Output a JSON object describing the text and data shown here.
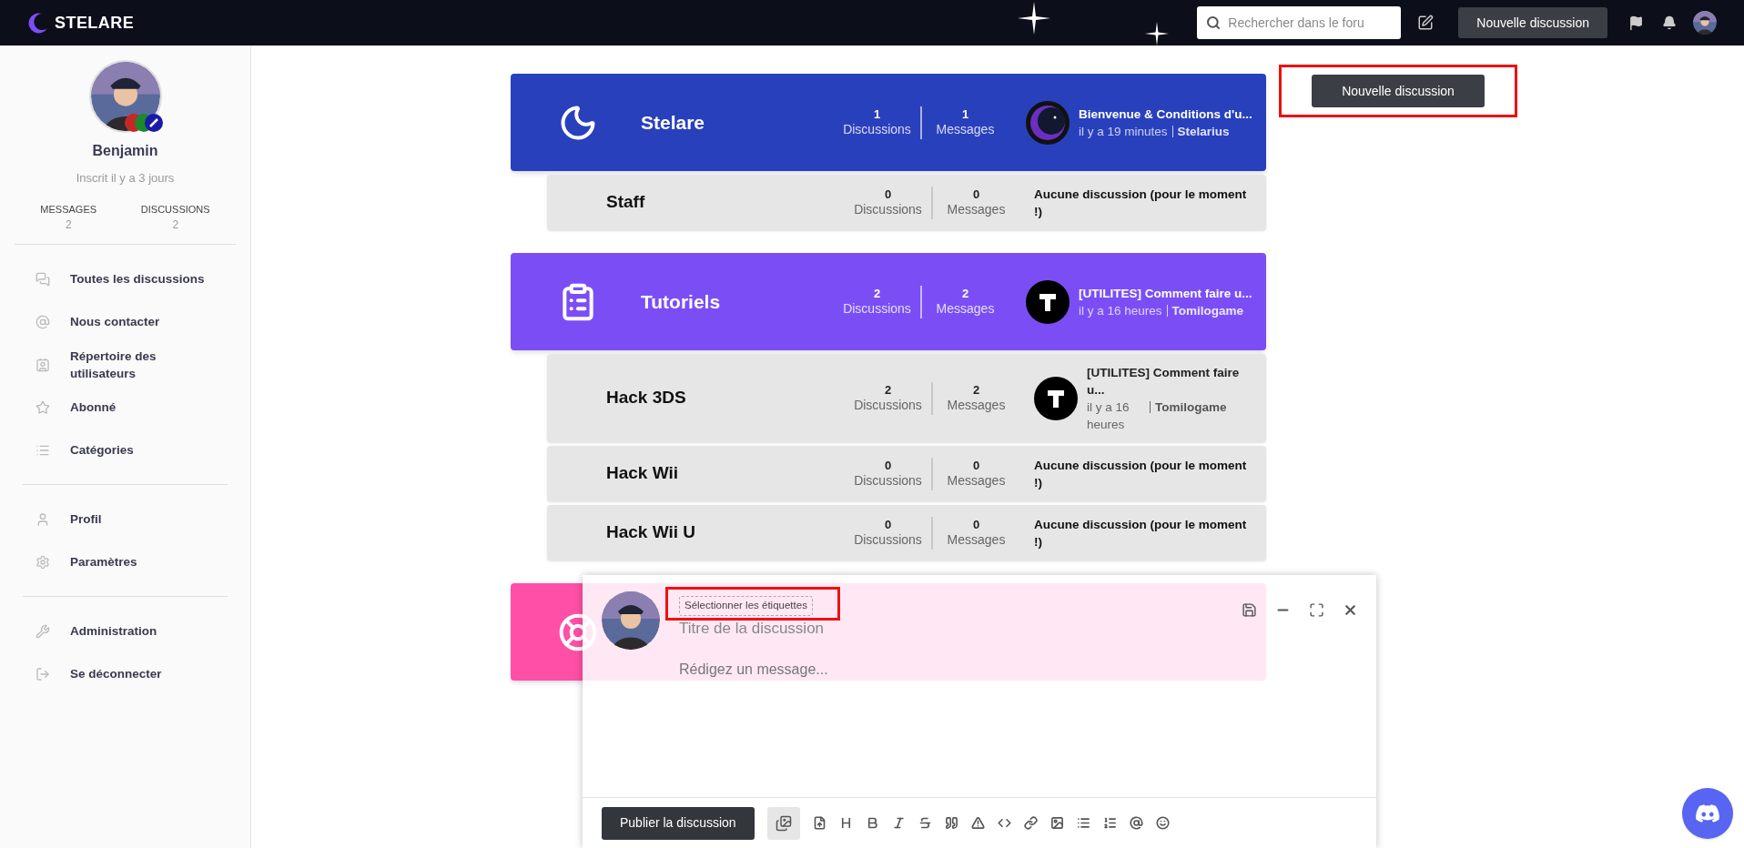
{
  "header": {
    "logo": "STELARE",
    "search": {
      "placeholder": "Rechercher dans le foru"
    },
    "new_button": "Nouvelle discussion"
  },
  "sidebar": {
    "user": {
      "name": "Benjamin",
      "joined": "Inscrit il y a 3 jours",
      "stats": [
        {
          "label": "MESSAGES",
          "value": "2"
        },
        {
          "label": "DISCUSSIONS",
          "value": "2"
        }
      ]
    },
    "nav_groups": [
      [
        "Toutes les discussions",
        "Nous contacter",
        "Répertoire des utilisateurs",
        "Abonné",
        "Catégories"
      ],
      [
        "Profil",
        "Paramètres"
      ],
      [
        "Administration",
        "Se déconnecter"
      ]
    ]
  },
  "new_discussion_button": "Nouvelle discussion",
  "categories": [
    {
      "name": "Stelare",
      "color": "#2940bd",
      "stats": [
        {
          "value": "1",
          "label": "Discussions"
        },
        {
          "value": "1",
          "label": "Messages"
        }
      ],
      "last": {
        "title": "Bienvenue & Conditions d'u...",
        "time": "il y a 19 minutes",
        "author": "Stelarius"
      },
      "children": [
        {
          "name": "Staff",
          "stats": [
            {
              "value": "0",
              "label": "Discussions"
            },
            {
              "value": "0",
              "label": "Messages"
            }
          ],
          "empty_text": "Aucune discussion (pour le moment !)"
        }
      ]
    },
    {
      "name": "Tutoriels",
      "color": "#7b4ef5",
      "stats": [
        {
          "value": "2",
          "label": "Discussions"
        },
        {
          "value": "2",
          "label": "Messages"
        }
      ],
      "last": {
        "title": "[UTILITES] Comment faire u...",
        "time": "il y a 16 heures",
        "author": "Tomilogame"
      },
      "children": [
        {
          "name": "Hack 3DS",
          "stats": [
            {
              "value": "2",
              "label": "Discussions"
            },
            {
              "value": "2",
              "label": "Messages"
            }
          ],
          "last": {
            "title": "[UTILITES] Comment faire u...",
            "time": "il y a 16 heures",
            "author": "Tomilogame"
          }
        },
        {
          "name": "Hack Wii",
          "stats": [
            {
              "value": "0",
              "label": "Discussions"
            },
            {
              "value": "0",
              "label": "Messages"
            }
          ],
          "empty_text": "Aucune discussion (pour le moment !)"
        },
        {
          "name": "Hack Wii U",
          "stats": [
            {
              "value": "0",
              "label": "Discussions"
            },
            {
              "value": "0",
              "label": "Messages"
            }
          ],
          "empty_text": "Aucune discussion (pour le moment !)"
        }
      ]
    },
    {
      "color": "#ff4fa6"
    }
  ],
  "composer": {
    "tags_button": "Sélectionner les étiquettes",
    "title_placeholder": "Titre de la discussion",
    "body_placeholder": "Rédigez un message...",
    "publish_button": "Publier la discussion",
    "gallery_active": true
  }
}
